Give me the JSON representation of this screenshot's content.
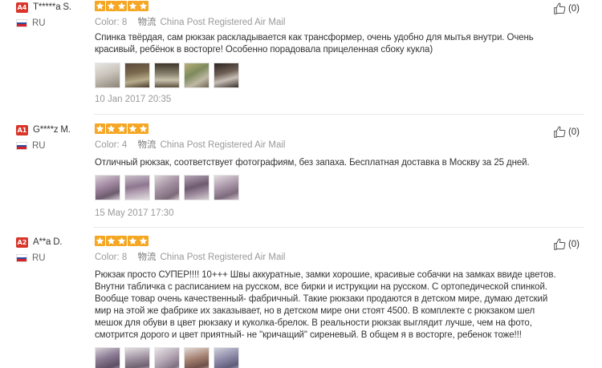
{
  "reviews": [
    {
      "level": "A4",
      "user": "T*****a S.",
      "country": "RU",
      "stars": 5,
      "color_label": "Color:",
      "color_value": "8",
      "shipping_label": "物流",
      "shipping_value": "China Post Registered Air Mail",
      "text": "Спинка твёрдая, сам рюкзак раскладывается как трансформер, очень удобно для мытья внутри. Очень красивый, ребёнок в восторге! Особенно порадовала прицеленная сбоку кукла)",
      "date": "10 Jan 2017 20:35",
      "helpful": "(0)"
    },
    {
      "level": "A1",
      "user": "G****z M.",
      "country": "RU",
      "stars": 5,
      "color_label": "Color:",
      "color_value": "4",
      "shipping_label": "物流",
      "shipping_value": "China Post Registered Air Mail",
      "text": "Отличный рюкзак, соответствует фотографиям, без запаха. Бесплатная доставка в Москву за 25 дней.",
      "date": "15 May 2017 17:30",
      "helpful": "(0)"
    },
    {
      "level": "A2",
      "user": "A**a D.",
      "country": "RU",
      "stars": 5,
      "color_label": "Color:",
      "color_value": "8",
      "shipping_label": "物流",
      "shipping_value": "China Post Registered Air Mail",
      "text": "Рюкзак просто СУПЕР!!!! 10+++ Швы аккуратные, замки хорошие, красивые собачки на замках ввиде цветов. Внутни табличка с расписанием на русском, все бирки и иструкции на русском. С ортопедической спинкой. Вообще товар очень качественный- фабричный. Такие рюкзаки продаются в детском мире, думаю детский мир на этой же фабрике их заказывает, но в детском мире они стоят 4500. В комплекте с рюкзаком шел мешок для обуви в цвет рюкзаку и куколка-брелок. В реальности рюкзак выглядит лучше, чем на фото, смотрится дорого и цвет приятный- не \"кричащий\" сиреневый. В общем я в восторге, ребенок тоже!!!",
      "date": "",
      "helpful": "(0)"
    }
  ],
  "colors": {
    "star": "#f5a623",
    "level_badge": "#d9352a",
    "meta_text": "#999999"
  },
  "icons": {
    "rating": "star-icon",
    "helpful": "thumbs-up-icon",
    "country": "russia-flag-icon"
  }
}
